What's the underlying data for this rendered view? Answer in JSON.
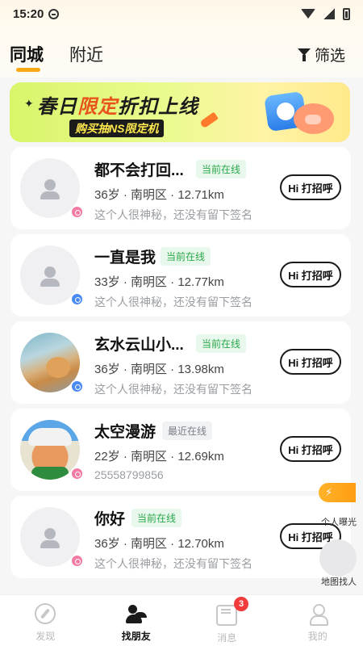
{
  "status_bar": {
    "time": "15:20"
  },
  "tabs": {
    "city": "同城",
    "nearby": "附近",
    "filter": "筛选"
  },
  "banner": {
    "title_a": "春日",
    "title_hl": "限定",
    "title_b": "折扣上线",
    "subtitle": "购买抽NS限定机"
  },
  "users": [
    {
      "name": "都不会打回...",
      "status": "当前在线",
      "status_type": "online",
      "age_loc_dist": "36岁 · 南明区 · 12.71km",
      "bio": "这个人很神秘，还没有留下签名",
      "gender": "female",
      "avatar": "placeholder",
      "hi_label": "Hi 打招呼"
    },
    {
      "name": "一直是我",
      "status": "当前在线",
      "status_type": "online",
      "age_loc_dist": "33岁 · 南明区 · 12.77km",
      "bio": "这个人很神秘，还没有留下签名",
      "gender": "male",
      "avatar": "placeholder",
      "hi_label": "Hi 打招呼"
    },
    {
      "name": "玄水云山小...",
      "status": "当前在线",
      "status_type": "online",
      "age_loc_dist": "36岁 · 南明区 · 13.98km",
      "bio": "这个人很神秘，还没有留下签名",
      "gender": "male",
      "avatar": "photo-dog",
      "hi_label": "Hi 打招呼"
    },
    {
      "name": "太空漫游",
      "status": "最近在线",
      "status_type": "recent",
      "age_loc_dist": "22岁 · 南明区 · 12.69km",
      "bio": "25558799856",
      "gender": "female",
      "avatar": "photo-cartoon",
      "hi_label": "Hi 打招呼"
    },
    {
      "name": "你好",
      "status": "当前在线",
      "status_type": "online",
      "age_loc_dist": "36岁 · 南明区 · 12.70km",
      "bio": "这个人很神秘，还没有留下签名",
      "gender": "female",
      "avatar": "placeholder",
      "hi_label": "Hi 打招呼"
    }
  ],
  "floating": {
    "exposure_label": "个人曝光",
    "map_label": "地图找人",
    "exposure_icon": "lightning-icon"
  },
  "bottom_nav": [
    {
      "label": "发现",
      "icon": "compass-icon",
      "active": false
    },
    {
      "label": "找朋友",
      "icon": "friends-icon",
      "active": true
    },
    {
      "label": "消息",
      "icon": "message-icon",
      "active": false,
      "badge": "3"
    },
    {
      "label": "我的",
      "icon": "profile-icon",
      "active": false
    }
  ],
  "colors": {
    "accent": "#f7a916",
    "online_text": "#2aa84a",
    "online_bg": "#e9f8ec",
    "badge_red": "#f23b3b"
  }
}
